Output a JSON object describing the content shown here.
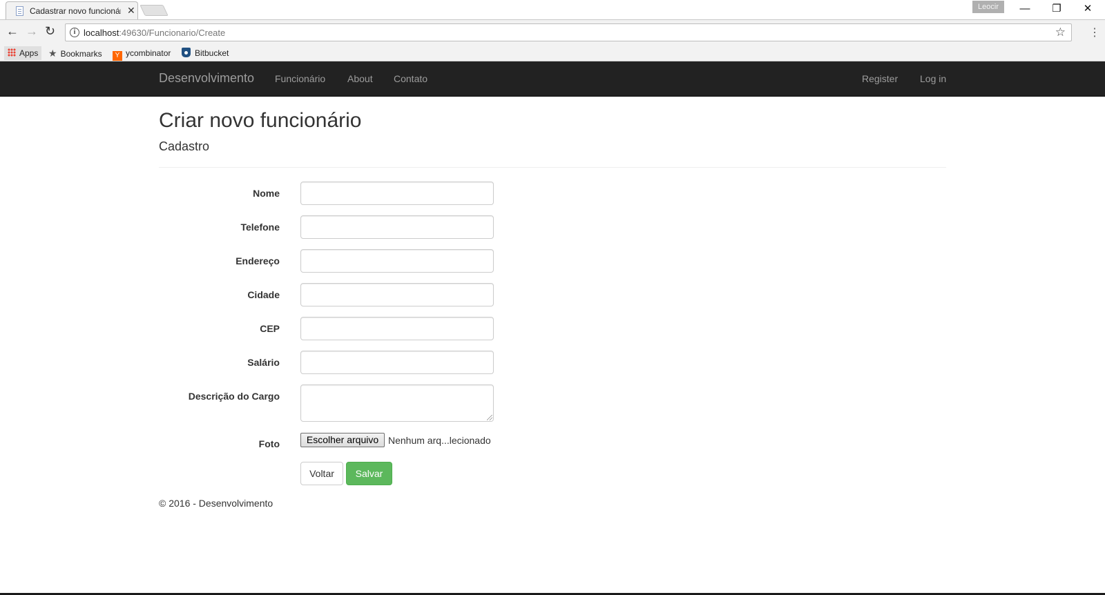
{
  "browser": {
    "tab_title": "Cadastrar novo funcionário",
    "profile_name": "Leocir",
    "url_host": "localhost",
    "url_rest": ":49630/Funcionario/Create",
    "bookmarks": {
      "apps": "Apps",
      "bookmarks": "Bookmarks",
      "ycombinator": "ycombinator",
      "ycombinator_logo": "Y",
      "bitbucket": "Bitbucket"
    },
    "window_controls": {
      "minimize": "—",
      "restore": "❐",
      "close": "✕"
    }
  },
  "navbar": {
    "brand": "Desenvolvimento",
    "links": [
      "Funcionário",
      "About",
      "Contato"
    ],
    "right_links": [
      "Register",
      "Log in"
    ]
  },
  "page": {
    "title": "Criar novo funcionário",
    "subtitle": "Cadastro"
  },
  "form": {
    "fields": {
      "nome": {
        "label": "Nome",
        "value": ""
      },
      "telefone": {
        "label": "Telefone",
        "value": ""
      },
      "endereco": {
        "label": "Endereço",
        "value": ""
      },
      "cidade": {
        "label": "Cidade",
        "value": ""
      },
      "cep": {
        "label": "CEP",
        "value": ""
      },
      "salario": {
        "label": "Salário",
        "value": ""
      },
      "descricao": {
        "label": "Descrição do Cargo",
        "value": ""
      },
      "foto": {
        "label": "Foto",
        "button": "Escolher arquivo",
        "status": "Nenhum arq...lecionado"
      }
    },
    "buttons": {
      "back": "Voltar",
      "save": "Salvar"
    }
  },
  "footer": {
    "text": "© 2016 - Desenvolvimento"
  },
  "colors": {
    "navbar_bg": "#222222",
    "nav_text": "#9d9d9d",
    "success": "#5cb85c"
  }
}
